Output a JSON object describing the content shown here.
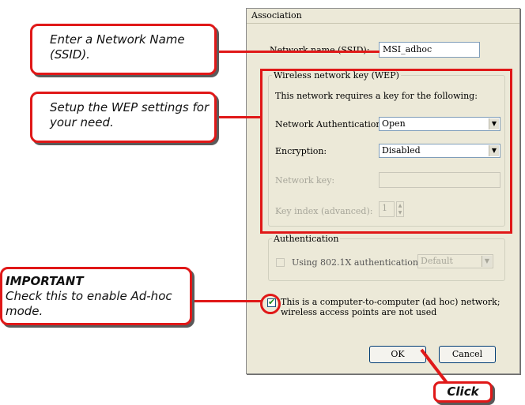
{
  "dialog": {
    "title": "Association",
    "ssid_label": "Network name (SSID):",
    "ssid_value": "MSI_adhoc",
    "wep_group_label": "Wireless network key (WEP)",
    "wep_note": "This network requires a key for the following:",
    "net_auth_label": "Network Authentication:",
    "net_auth_value": "Open",
    "encryption_label": "Encryption:",
    "encryption_value": "Disabled",
    "network_key_label": "Network key:",
    "key_index_label": "Key index (advanced):",
    "key_index_value": "1",
    "auth_group_label": "Authentication",
    "use_8021x_label": "Using 802.1X authentication",
    "eap_value": "Default",
    "adhoc_line1": "This is a computer-to-computer (ad hoc) network;",
    "adhoc_line2": "wireless access points are not used",
    "ok_label": "OK",
    "cancel_label": "Cancel"
  },
  "callouts": {
    "ssid": "Enter a Network Name (SSID).",
    "wep": "Setup the WEP settings for your need.",
    "important_heading": "IMPORTANT",
    "important_body": "Check this to enable Ad-hoc mode.",
    "click": "Click"
  },
  "colors": {
    "highlight": "#e01818",
    "dialog_bg": "#ece9d8"
  }
}
